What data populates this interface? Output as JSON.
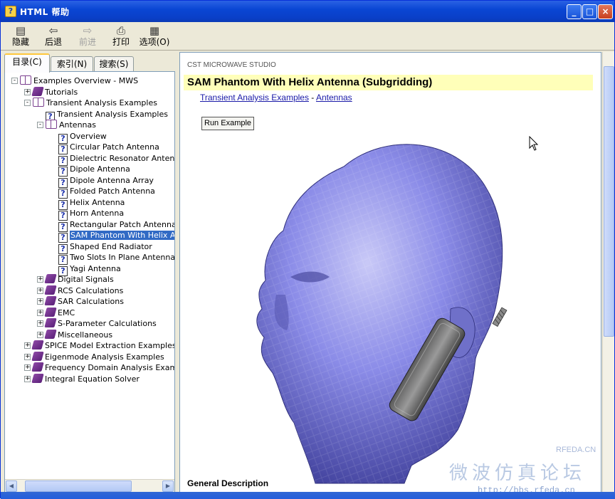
{
  "window": {
    "title": "HTML 帮助",
    "app_icon": "help-book-icon"
  },
  "toolbar": {
    "buttons": [
      {
        "label": "隐藏",
        "icon": "hide-pane-icon",
        "enabled": true
      },
      {
        "label": "后退",
        "icon": "back-arrow-icon",
        "enabled": true
      },
      {
        "label": "前进",
        "icon": "forward-arrow-icon",
        "enabled": false
      },
      {
        "label": "打印",
        "icon": "printer-icon",
        "enabled": true
      },
      {
        "label": "选项(O)",
        "icon": "options-icon",
        "enabled": true
      }
    ]
  },
  "tabs": [
    {
      "label": "目录(C)",
      "active": true
    },
    {
      "label": "索引(N)",
      "active": false
    },
    {
      "label": "搜索(S)",
      "active": false
    }
  ],
  "tree": [
    {
      "label": "Examples Overview - MWS",
      "type": "book-open",
      "depth": 0,
      "expander": "-"
    },
    {
      "label": "Tutorials",
      "type": "book",
      "depth": 1,
      "expander": "+"
    },
    {
      "label": "Transient Analysis Examples",
      "type": "book-open",
      "depth": 1,
      "expander": "-"
    },
    {
      "label": "Transient Analysis Examples",
      "type": "page",
      "depth": 2,
      "expander": ""
    },
    {
      "label": "Antennas",
      "type": "book-open",
      "depth": 2,
      "expander": "-"
    },
    {
      "label": "Overview",
      "type": "page",
      "depth": 3,
      "expander": ""
    },
    {
      "label": "Circular Patch Antenna",
      "type": "page",
      "depth": 3,
      "expander": ""
    },
    {
      "label": "Dielectric Resonator Antenna",
      "type": "page",
      "depth": 3,
      "expander": ""
    },
    {
      "label": "Dipole Antenna",
      "type": "page",
      "depth": 3,
      "expander": ""
    },
    {
      "label": "Dipole Antenna Array",
      "type": "page",
      "depth": 3,
      "expander": ""
    },
    {
      "label": "Folded Patch Antenna",
      "type": "page",
      "depth": 3,
      "expander": ""
    },
    {
      "label": "Helix Antenna",
      "type": "page",
      "depth": 3,
      "expander": ""
    },
    {
      "label": "Horn Antenna",
      "type": "page",
      "depth": 3,
      "expander": ""
    },
    {
      "label": "Rectangular Patch Antenna",
      "type": "page",
      "depth": 3,
      "expander": ""
    },
    {
      "label": "SAM Phantom With Helix Ant",
      "type": "page",
      "depth": 3,
      "expander": "",
      "selected": true
    },
    {
      "label": "Shaped End Radiator",
      "type": "page",
      "depth": 3,
      "expander": ""
    },
    {
      "label": "Two Slots In Plane Antenna",
      "type": "page",
      "depth": 3,
      "expander": ""
    },
    {
      "label": "Yagi Antenna",
      "type": "page",
      "depth": 3,
      "expander": ""
    },
    {
      "label": "Digital Signals",
      "type": "book",
      "depth": 2,
      "expander": "+"
    },
    {
      "label": "RCS Calculations",
      "type": "book",
      "depth": 2,
      "expander": "+"
    },
    {
      "label": "SAR Calculations",
      "type": "book",
      "depth": 2,
      "expander": "+"
    },
    {
      "label": "EMC",
      "type": "book",
      "depth": 2,
      "expander": "+"
    },
    {
      "label": "S-Parameter Calculations",
      "type": "book",
      "depth": 2,
      "expander": "+"
    },
    {
      "label": "Miscellaneous",
      "type": "book",
      "depth": 2,
      "expander": "+"
    },
    {
      "label": "SPICE Model Extraction Examples",
      "type": "book",
      "depth": 1,
      "expander": "+"
    },
    {
      "label": "Eigenmode Analysis Examples",
      "type": "book",
      "depth": 1,
      "expander": "+"
    },
    {
      "label": "Frequency Domain Analysis Examples",
      "type": "book",
      "depth": 1,
      "expander": "+"
    },
    {
      "label": "Integral Equation Solver",
      "type": "book",
      "depth": 1,
      "expander": "+"
    }
  ],
  "content": {
    "product": "CST MICROWAVE STUDIO",
    "heading": "SAM Phantom With Helix Antenna (Subgridding)",
    "crumb_1": "Transient Analysis Examples",
    "crumb_sep": " - ",
    "crumb_2": "Antennas",
    "run_button": "Run Example",
    "section": "General Description",
    "figure_icon": "sam-phantom-head-with-phone-image"
  },
  "watermark": {
    "cn": "微波仿真论坛",
    "rf": "RFEDA.CN",
    "url": "http://bbs.rfeda.cn"
  },
  "colors": {
    "heading_bg": "#ffffb9",
    "link": "#1a1aa8",
    "selection": "#316ac5",
    "titlebar": "#0a46d4",
    "head_fill": "#8b8ce8"
  }
}
